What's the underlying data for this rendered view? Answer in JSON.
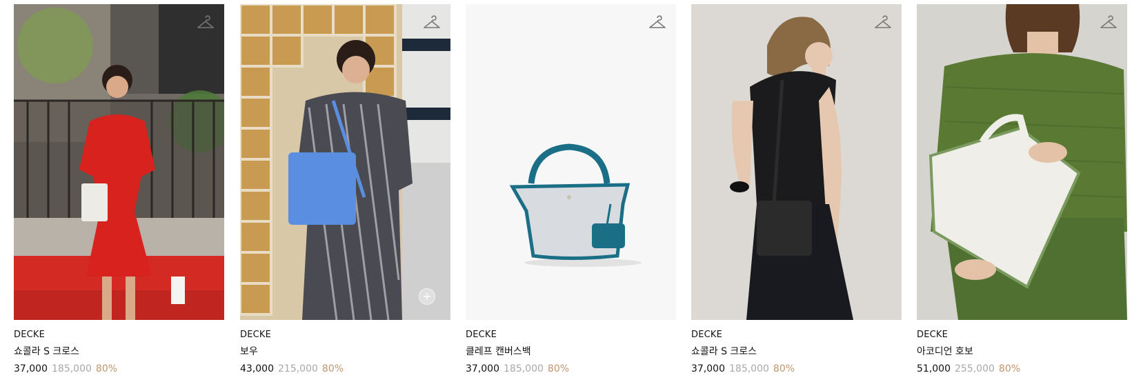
{
  "products": [
    {
      "brand": "DECKE",
      "name": "쇼콜라 S 크로스",
      "price": "37,000",
      "original_price": "185,000",
      "discount": "80%"
    },
    {
      "brand": "DECKE",
      "name": "보우",
      "price": "43,000",
      "original_price": "215,000",
      "discount": "80%"
    },
    {
      "brand": "DECKE",
      "name": "클레프 캔버스백",
      "price": "37,000",
      "original_price": "185,000",
      "discount": "80%"
    },
    {
      "brand": "DECKE",
      "name": "쇼콜라 S 크로스",
      "price": "37,000",
      "original_price": "185,000",
      "discount": "80%"
    },
    {
      "brand": "DECKE",
      "name": "아코디언 호보",
      "price": "51,000",
      "original_price": "255,000",
      "discount": "80%"
    }
  ],
  "icons": {
    "wishlist": "hanger-icon",
    "zoom": "plus-circle-icon"
  },
  "colors": {
    "discount": "#c3956b",
    "original_price": "#a8a8a8",
    "text": "#111111"
  }
}
